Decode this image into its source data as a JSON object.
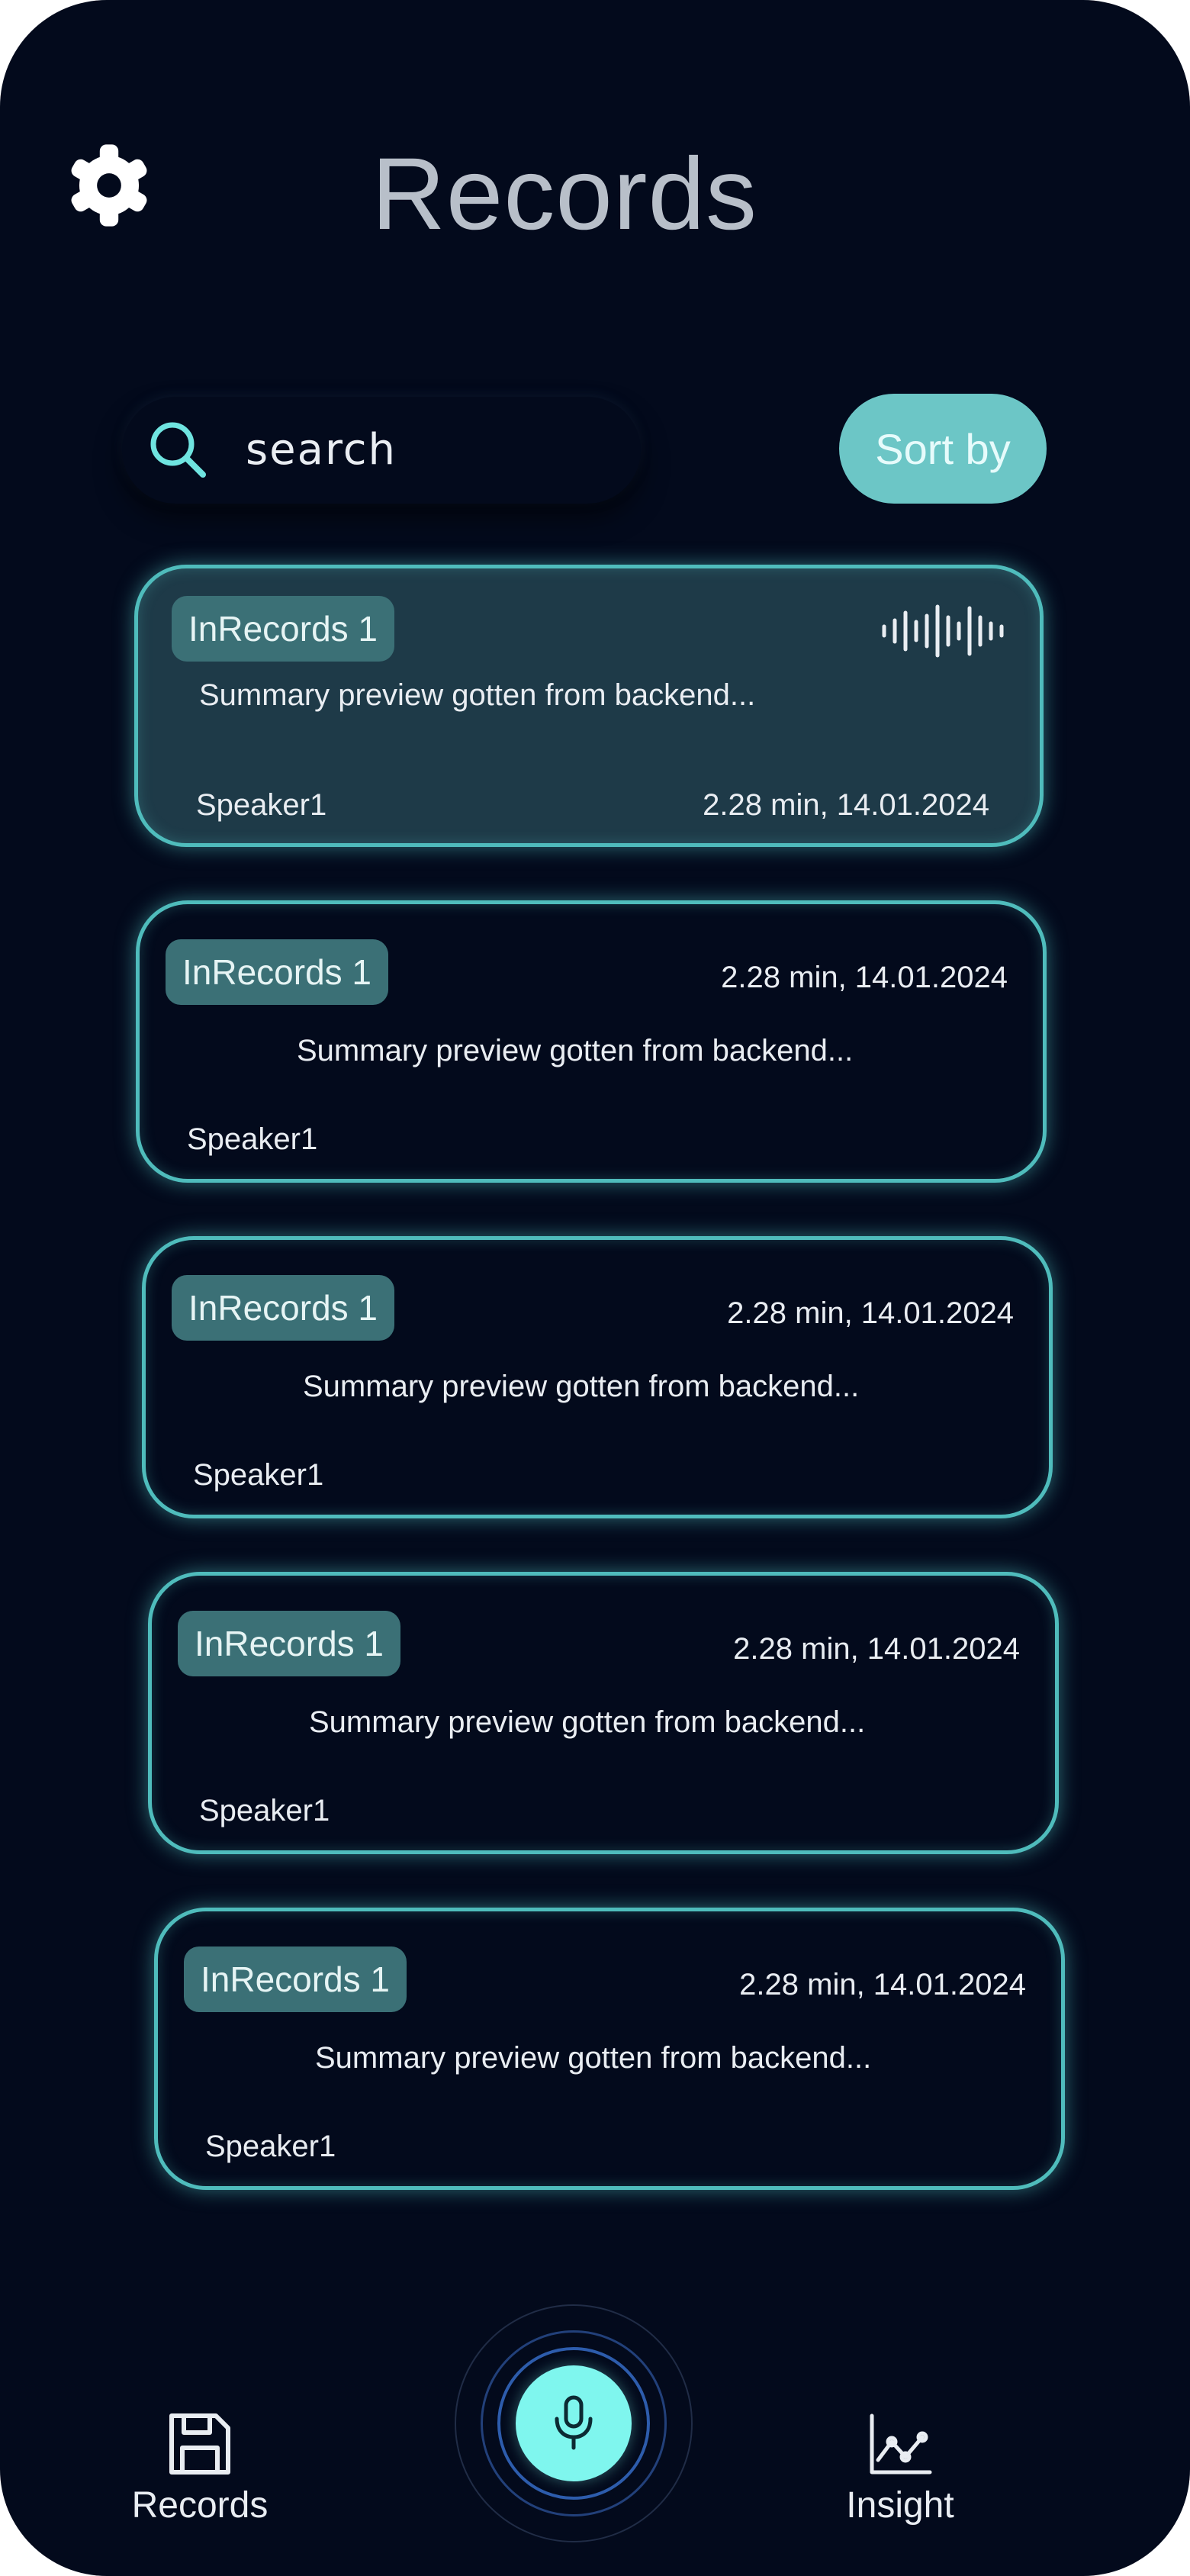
{
  "header": {
    "title": "Records"
  },
  "search": {
    "placeholder": "search"
  },
  "sort": {
    "label": "Sort by"
  },
  "records": [
    {
      "tag": "InRecords 1",
      "summary": "Summary preview gotten from backend...",
      "speaker": "Speaker1",
      "meta": "2.28 min, 14.01.2024"
    },
    {
      "tag": "InRecords 1",
      "summary": "Summary preview gotten from backend...",
      "speaker": "Speaker1",
      "meta": "2.28 min, 14.01.2024"
    },
    {
      "tag": "InRecords 1",
      "summary": "Summary preview gotten from backend...",
      "speaker": "Speaker1",
      "meta": "2.28 min, 14.01.2024"
    },
    {
      "tag": "InRecords 1",
      "summary": "Summary preview gotten from backend...",
      "speaker": "Speaker1",
      "meta": "2.28 min, 14.01.2024"
    },
    {
      "tag": "InRecords 1",
      "summary": "Summary preview gotten from backend...",
      "speaker": "Speaker1",
      "meta": "2.28 min, 14.01.2024"
    }
  ],
  "nav": {
    "records_label": "Records",
    "insight_label": "Insight"
  },
  "icons": {
    "settings": "gear-icon",
    "search": "search-icon",
    "waveform": "waveform-icon",
    "records_nav": "save-icon",
    "insight_nav": "chart-line-icon",
    "record_button": "microphone-icon"
  },
  "colors": {
    "background": "#030a1c",
    "accent": "#4fbcbc",
    "sort_button": "#6cc6c6",
    "tag": "#3b7076",
    "active_card": "#1e3a48",
    "mic_button": "#7ff6ee"
  }
}
